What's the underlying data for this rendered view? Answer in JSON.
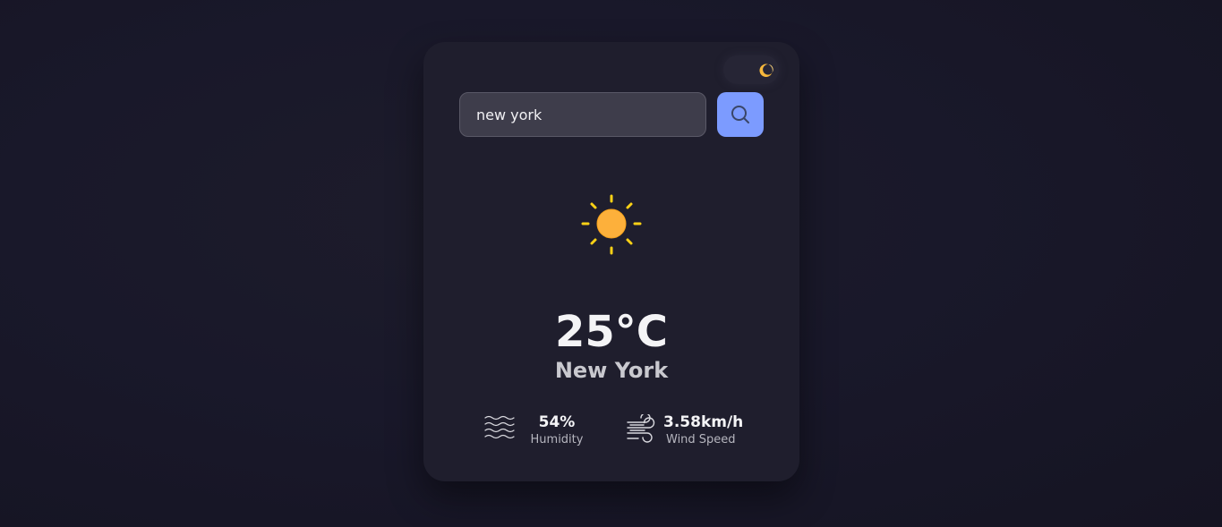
{
  "theme_toggle": {
    "icon": "moon-icon"
  },
  "search": {
    "value": "new york",
    "placeholder": "",
    "button_icon": "search-icon"
  },
  "weather": {
    "icon": "sun-icon",
    "temperature": "25°C",
    "city": "New York"
  },
  "details": {
    "humidity": {
      "icon": "waves-icon",
      "value": "54%",
      "label": "Humidity"
    },
    "wind": {
      "icon": "wind-icon",
      "value": "3.58km/h",
      "label": "Wind Speed"
    }
  },
  "colors": {
    "background": "#19182a",
    "card": "#1f1e2d",
    "input": "#3e3d4b",
    "accent": "#7c9bff",
    "sun": "#fdb03b",
    "sun_rays": "#fcd116"
  }
}
